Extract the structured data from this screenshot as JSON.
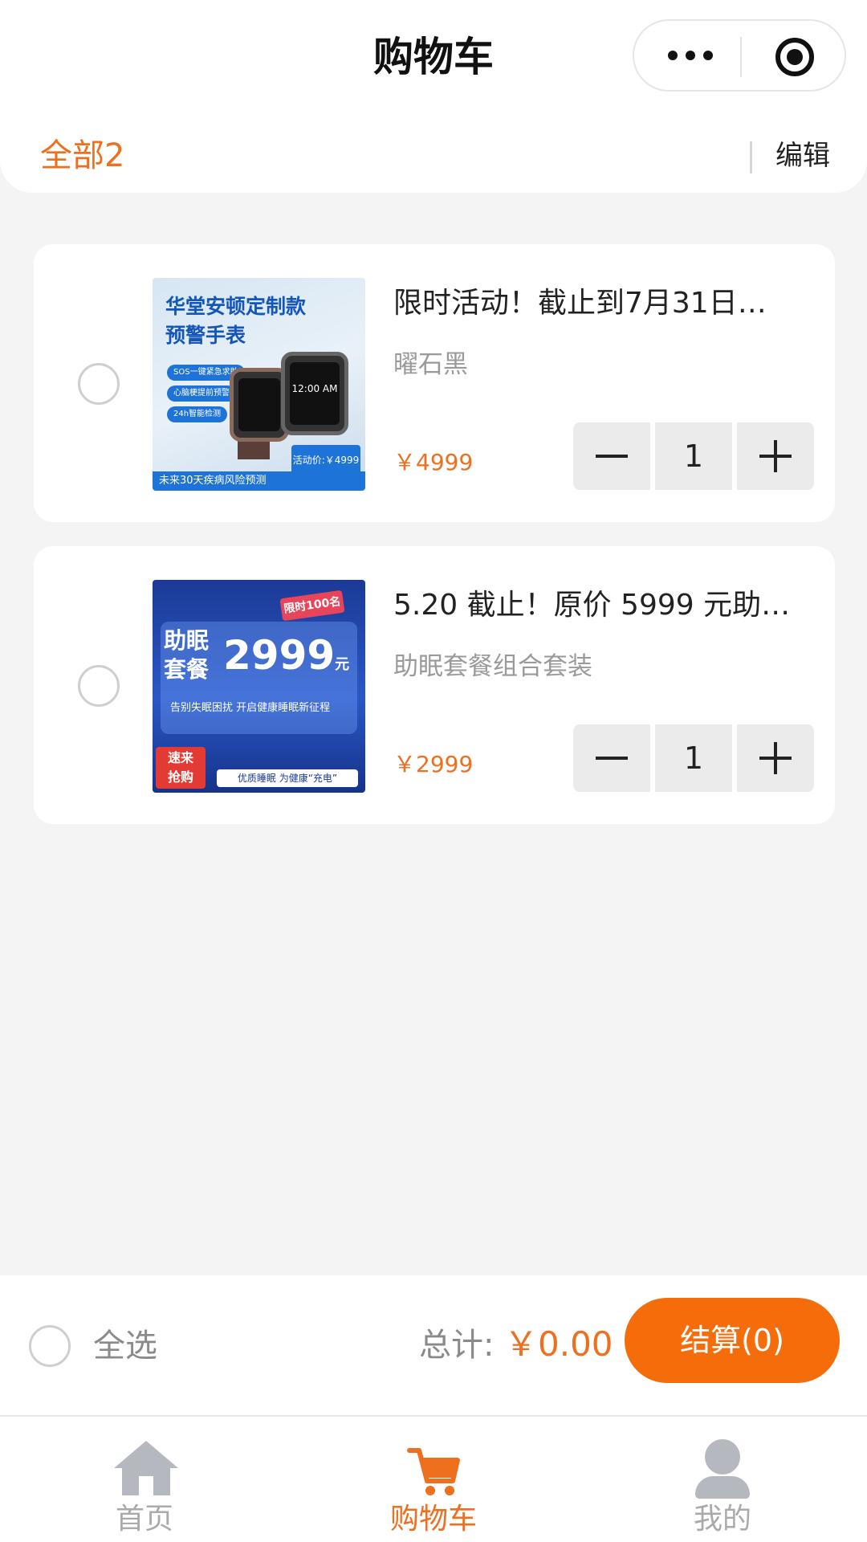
{
  "header": {
    "title": "购物车",
    "filter_label": "全部2",
    "edit_label": "编辑"
  },
  "items": [
    {
      "name": "限时活动！截止到7月31日…",
      "spec": "曜石黑",
      "price": "￥4999",
      "quantity": "1",
      "image": {
        "headline_1": "华堂安顿定制款",
        "headline_2": "预警手表",
        "chips": [
          "SOS一键紧急求助",
          "心脑梗提前预警",
          "24h智能检测"
        ],
        "watch_time": "12:00 AM",
        "price_box": "活动价:￥4999",
        "footer": "未来30天疾病风险预测"
      }
    },
    {
      "name": "5.20 截止！原价 5999 元助…",
      "spec": "助眠套餐组合套装",
      "price": "￥2999",
      "quantity": "1",
      "image": {
        "ribbon": "限时100名",
        "title_1": "助眠",
        "title_2": "套餐",
        "number": "2999",
        "unit": "元",
        "sub": "告别失眠困扰 开启健康睡眠新征程",
        "badge_1": "速来",
        "badge_2": "抢购",
        "tag": "优质睡眠 为健康“充电”"
      }
    }
  ],
  "checkout": {
    "select_all_label": "全选",
    "total_label": "总计:",
    "total_amount": "￥0.00",
    "pay_button": "结算(0)"
  },
  "tabbar": {
    "items": [
      {
        "label": "首页",
        "icon": "home-icon"
      },
      {
        "label": "购物车",
        "icon": "cart-icon"
      },
      {
        "label": "我的",
        "icon": "user-icon"
      }
    ],
    "active_index": 1
  },
  "colors": {
    "accent": "#ee6f1e",
    "pay_button": "#f56d0b",
    "muted_text": "#8a8a8a",
    "background": "#f4f4f4"
  }
}
